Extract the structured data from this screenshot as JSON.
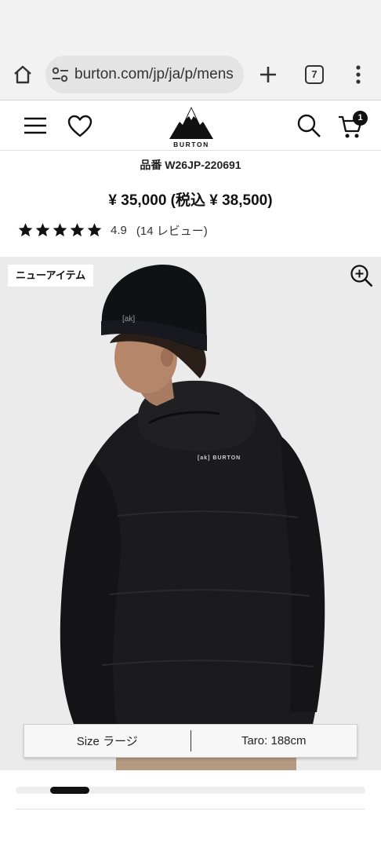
{
  "browser": {
    "url": "burton.com/jp/ja/p/mens",
    "tab_count": "7"
  },
  "header": {
    "logo_text": "BURTON",
    "cart_count": "1"
  },
  "product": {
    "sku": "品番 W26JP-220691",
    "price": "¥ 35,000 (税込 ¥ 38,500)",
    "rating_stars": 5,
    "rating_value": "4.9",
    "review_count": "(14 レビュー)",
    "badge": "ニューアイテム",
    "size_label": "Size ラージ",
    "model_label": "Taro: 188cm",
    "jacket_print": "[ak] BURTON",
    "beanie_print": "[ak]"
  },
  "carousel": {
    "position": 0.11
  },
  "colors": {
    "chrome_bg": "#f2f2f2",
    "url_pill": "#e4e4e4",
    "media_bg": "#ebebeb",
    "text": "#111111"
  },
  "icons": [
    "home-icon",
    "tune-icon",
    "plus-icon",
    "tabs-icon",
    "more-vert-icon",
    "menu-icon",
    "heart-icon",
    "search-icon",
    "cart-icon",
    "star-icon",
    "zoom-in-icon"
  ]
}
